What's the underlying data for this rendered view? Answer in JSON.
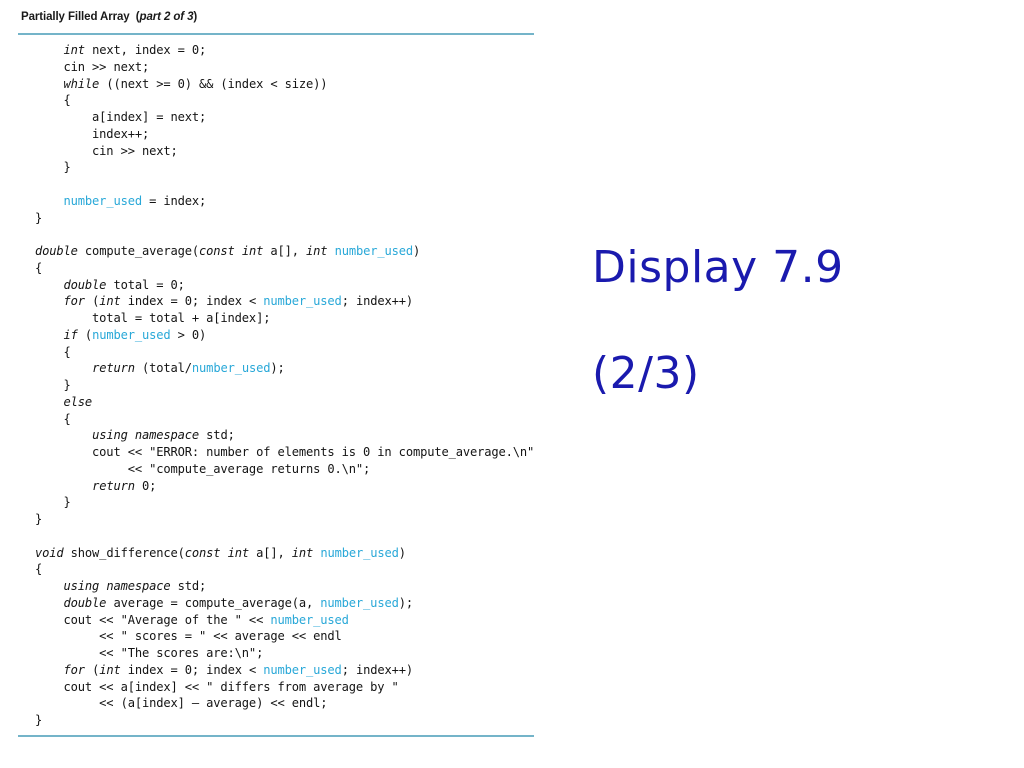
{
  "figure": {
    "caption_main": "Partially Filled Array",
    "caption_part": "part 2 of 3",
    "paren_open": "(",
    "paren_close": ")"
  },
  "display_title": {
    "line1": "Display 7.9",
    "line2": "(2/3)"
  },
  "colors": {
    "rule": "#74b4c9",
    "highlight_identifier": "#29a8d8",
    "title_blue": "#1a1aae",
    "code_text": "#141414",
    "background": "#ffffff"
  },
  "code": {
    "language": "C++",
    "highlighted_identifier": "number_used",
    "lines": [
      {
        "id": 1,
        "text": "    int next, index = 0;"
      },
      {
        "id": 2,
        "text": "    cin >> next;"
      },
      {
        "id": 3,
        "text": "    while ((next >= 0) && (index < size))"
      },
      {
        "id": 4,
        "text": "    {"
      },
      {
        "id": 5,
        "text": "        a[index] = next;"
      },
      {
        "id": 6,
        "text": "        index++;"
      },
      {
        "id": 7,
        "text": "        cin >> next;"
      },
      {
        "id": 8,
        "text": "    }"
      },
      {
        "id": 9,
        "text": ""
      },
      {
        "id": 10,
        "text": "    number_used = index;"
      },
      {
        "id": 11,
        "text": "}"
      },
      {
        "id": 12,
        "text": ""
      },
      {
        "id": 13,
        "text": "double compute_average(const int a[], int number_used)"
      },
      {
        "id": 14,
        "text": "{"
      },
      {
        "id": 15,
        "text": "    double total = 0;"
      },
      {
        "id": 16,
        "text": "    for (int index = 0; index < number_used; index++)"
      },
      {
        "id": 17,
        "text": "        total = total + a[index];"
      },
      {
        "id": 18,
        "text": "    if (number_used > 0)"
      },
      {
        "id": 19,
        "text": "    {"
      },
      {
        "id": 20,
        "text": "        return (total/number_used);"
      },
      {
        "id": 21,
        "text": "    }"
      },
      {
        "id": 22,
        "text": "    else"
      },
      {
        "id": 23,
        "text": "    {"
      },
      {
        "id": 24,
        "text": "        using namespace std;"
      },
      {
        "id": 25,
        "text": "        cout << \"ERROR: number of elements is 0 in compute_average.\\n\""
      },
      {
        "id": 26,
        "text": "             << \"compute_average returns 0.\\n\";"
      },
      {
        "id": 27,
        "text": "        return 0;"
      },
      {
        "id": 28,
        "text": "    }"
      },
      {
        "id": 29,
        "text": "}"
      },
      {
        "id": 30,
        "text": ""
      },
      {
        "id": 31,
        "text": "void show_difference(const int a[], int number_used)"
      },
      {
        "id": 32,
        "text": "{"
      },
      {
        "id": 33,
        "text": "    using namespace std;"
      },
      {
        "id": 34,
        "text": "    double average = compute_average(a, number_used);"
      },
      {
        "id": 35,
        "text": "    cout << \"Average of the \" << number_used"
      },
      {
        "id": 36,
        "text": "         << \" scores = \" << average << endl"
      },
      {
        "id": 37,
        "text": "         << \"The scores are:\\n\";"
      },
      {
        "id": 38,
        "text": "    for (int index = 0; index < number_used; index++)"
      },
      {
        "id": 39,
        "text": "    cout << a[index] << \" differs from average by \""
      },
      {
        "id": 40,
        "text": "         << (a[index] – average) << endl;"
      },
      {
        "id": 41,
        "text": "}"
      }
    ],
    "keywords_italic": [
      "int",
      "while",
      "double",
      "for",
      "if",
      "else",
      "return",
      "const",
      "void",
      "using",
      "namespace"
    ]
  }
}
